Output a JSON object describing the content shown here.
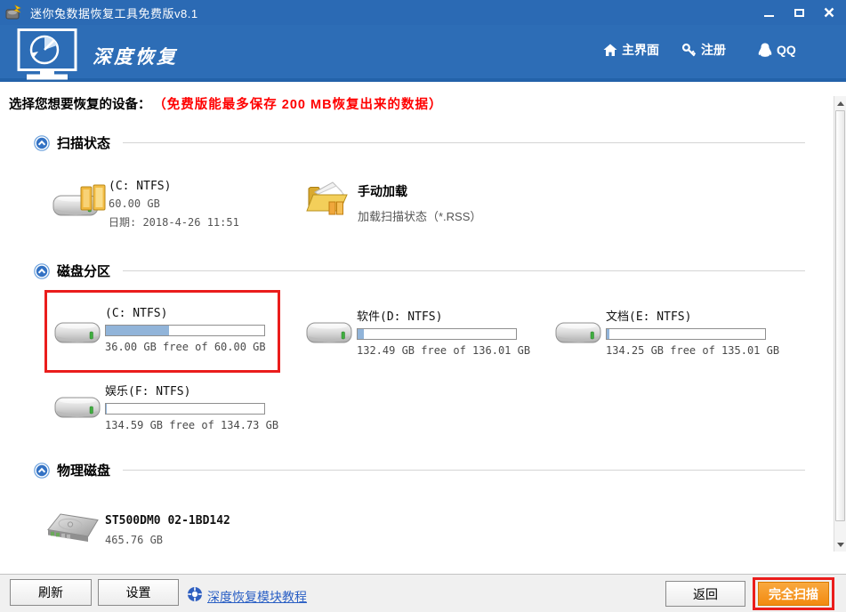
{
  "window": {
    "title": "迷你兔数据恢复工具免费版v8.1"
  },
  "header": {
    "brand": "深度恢复",
    "nav": [
      {
        "label": "主界面",
        "icon": "home-icon"
      },
      {
        "label": "注册",
        "icon": "key-icon"
      },
      {
        "label": "QQ",
        "icon": "qq-icon"
      }
    ]
  },
  "notice": {
    "prompt": "选择您想要恢复的设备：",
    "warning": "（免费版能最多保存 200 MB恢复出来的数据）"
  },
  "sections": {
    "scan_status": "扫描状态",
    "disk_partitions": "磁盘分区",
    "physical_disks": "物理磁盘"
  },
  "scan_status": {
    "saved": {
      "name": "(C: NTFS)",
      "size": "60.00 GB",
      "date": "日期: 2018-4-26 11:51"
    },
    "manual": {
      "title": "手动加载",
      "subtitle": "加载扫描状态（*.RSS）"
    }
  },
  "partitions": [
    {
      "name": "(C: NTFS)",
      "free_text": "36.00 GB free of 60.00 GB",
      "used_percent": 40,
      "highlighted": true
    },
    {
      "name": "软件(D: NTFS)",
      "free_text": "132.49 GB free of 136.01 GB",
      "used_percent": 4,
      "highlighted": false
    },
    {
      "name": "文档(E: NTFS)",
      "free_text": "134.25 GB free of 135.01 GB",
      "used_percent": 1.5,
      "highlighted": false
    },
    {
      "name": "娱乐(F: NTFS)",
      "free_text": "134.59 GB free of 134.73 GB",
      "used_percent": 0.8,
      "highlighted": false
    }
  ],
  "physical_disks": [
    {
      "model": "ST500DM0 02-1BD142",
      "size": "465.76 GB"
    }
  ],
  "footer": {
    "refresh": "刷新",
    "settings": "设置",
    "tutorial": "深度恢复模块教程",
    "back": "返回",
    "full_scan": "完全扫描"
  },
  "colors": {
    "titlebar_blue": "#2b6ab4",
    "header_blue": "#2d6db6",
    "warning_red": "#ff0000",
    "highlight_ring_red": "#ea1d1c",
    "bar_fill_blue": "#91b4d9",
    "full_scan_orange": "#f7941d",
    "link_blue": "#2a5fc4"
  }
}
